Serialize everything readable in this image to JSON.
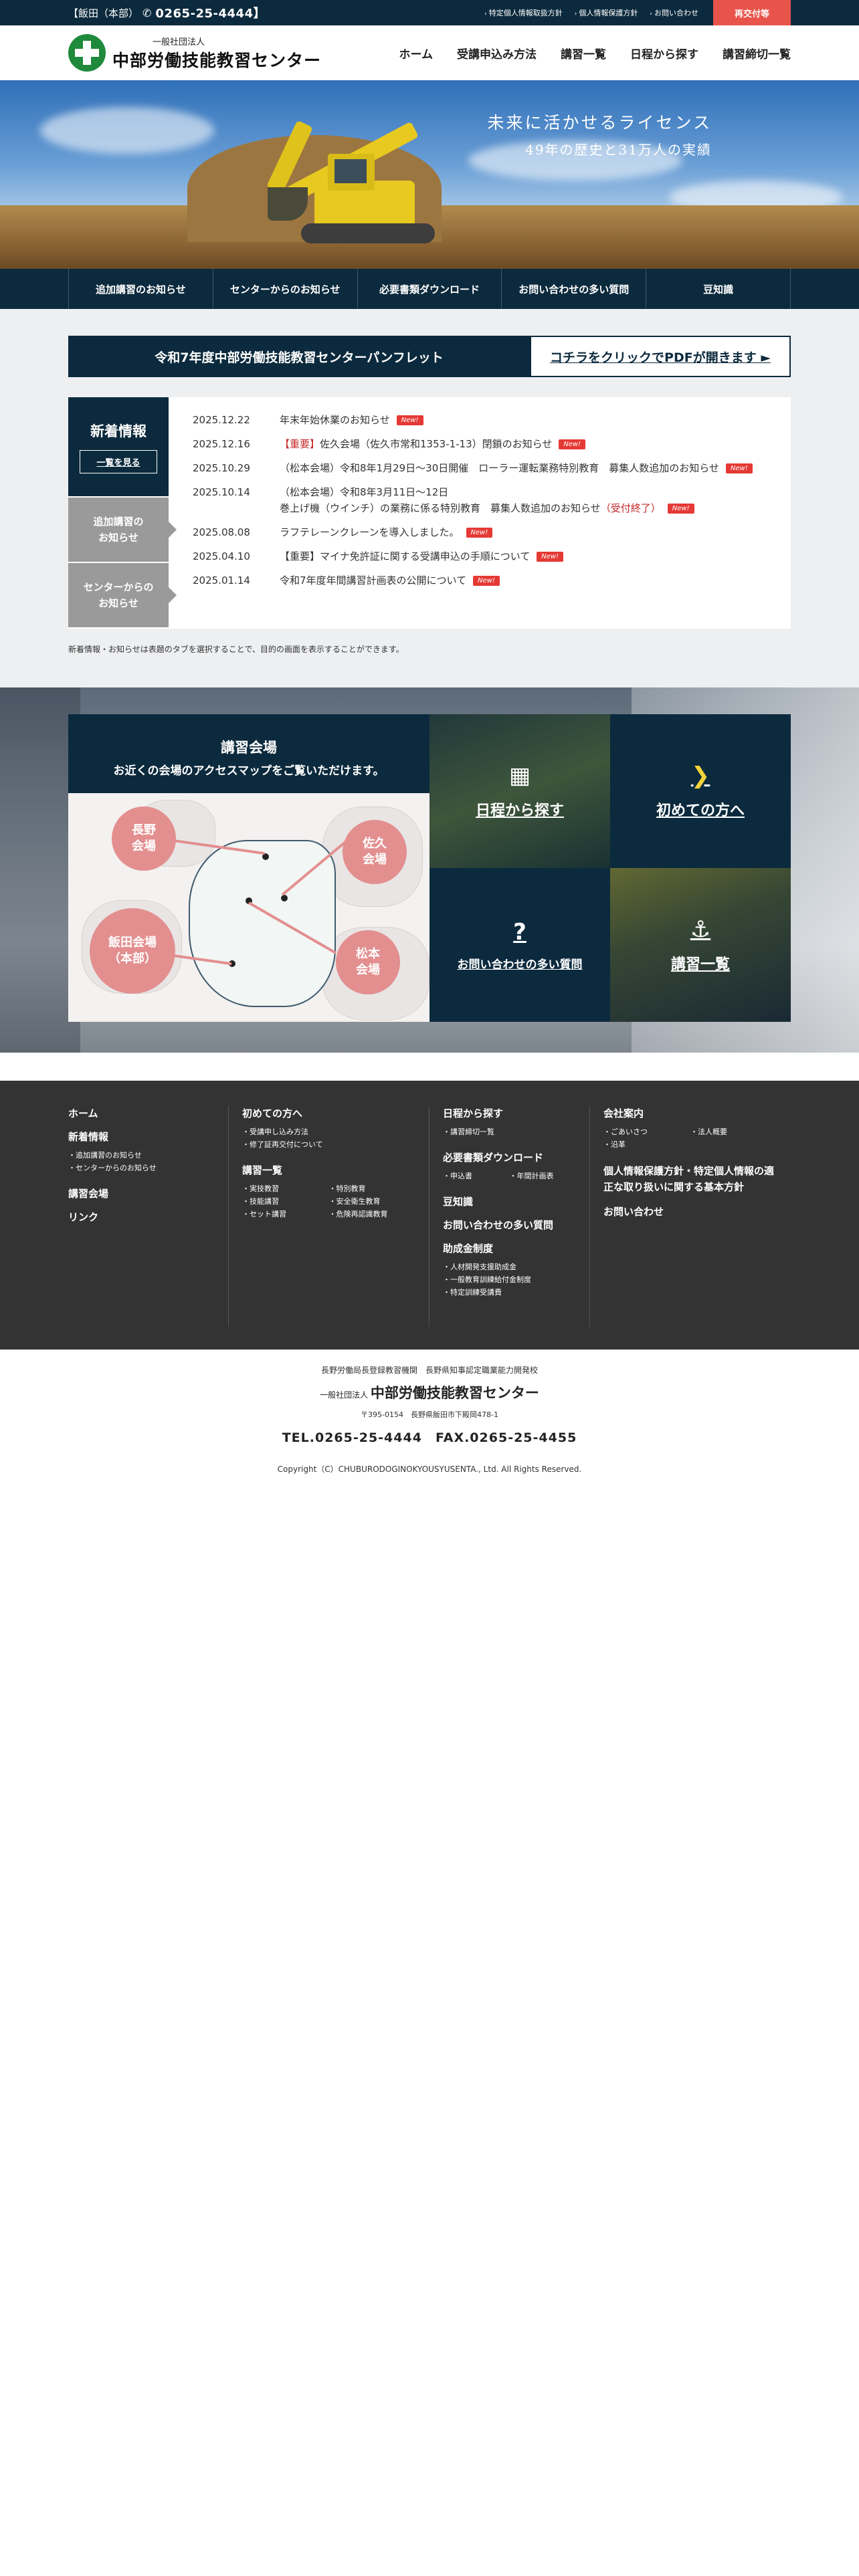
{
  "topbar": {
    "phone_label": "【飯田（本部）",
    "phone_number": "0265-25-4444】",
    "links": [
      "特定個人情報取扱方針",
      "個人情報保護方針",
      "お問い合わせ"
    ],
    "reissue": "再交付等"
  },
  "header": {
    "org_type": "一般社団法人",
    "org_name": "中部労働技能教習センター",
    "nav": [
      "ホーム",
      "受講申込み方法",
      "講習一覧",
      "日程から探す",
      "講習締切一覧"
    ]
  },
  "hero": {
    "line1": "未来に活かせるライセンス",
    "line2": "49年の歴史と31万人の実績"
  },
  "subnav": [
    "追加講習のお知らせ",
    "センターからのお知らせ",
    "必要書類ダウンロード",
    "お問い合わせの多い質問",
    "豆知識"
  ],
  "pamphlet": {
    "title": "令和7年度中部労働技能教習センターパンフレット",
    "link": "コチラをクリックでPDFが開きます ►"
  },
  "news": {
    "tab_title": "新着情報",
    "tab_more": "一覧を見る",
    "tab_additional_1": "追加講習の",
    "tab_additional_2": "お知らせ",
    "tab_center_1": "センターからの",
    "tab_center_2": "お知らせ",
    "new_label": "New!",
    "items": [
      {
        "date": "2025.12.22",
        "important": "",
        "text": "年末年始休業のお知らせ",
        "suffix": ""
      },
      {
        "date": "2025.12.16",
        "important": "【重要】",
        "text": "佐久会場（佐久市常和1353-1-13）閉鎖のお知らせ",
        "suffix": ""
      },
      {
        "date": "2025.10.29",
        "important": "",
        "text": "（松本会場）令和8年1月29日〜30日開催　ローラー運転業務特別教育　募集人数追加のお知らせ",
        "suffix": ""
      },
      {
        "date": "2025.10.14",
        "important": "",
        "text": "（松本会場）令和8年3月11日〜12日",
        "text2": "巻上げ機（ウインチ）の業務に係る特別教育　募集人数追加のお知らせ",
        "suffix": "（受付終了）"
      },
      {
        "date": "2025.08.08",
        "important": "",
        "text": "ラフテレーンクレーンを導入しました。",
        "suffix": ""
      },
      {
        "date": "2025.04.10",
        "important": "",
        "text": "【重要】マイナ免許証に関する受講申込の手順について",
        "suffix": ""
      },
      {
        "date": "2025.01.14",
        "important": "",
        "text": "令和7年度年間講習計画表の公開について",
        "suffix": ""
      }
    ],
    "note": "新着情報・お知らせは表題のタブを選択することで、目的の画面を表示することができます。"
  },
  "venue": {
    "title": "講習会場",
    "subtitle": "お近くの会場のアクセスマップをご覧いただけます。",
    "pins": {
      "nagano_1": "長野",
      "nagano_2": "会場",
      "saku_1": "佐久",
      "saku_2": "会場",
      "iida_1": "飯田会場",
      "iida_2": "（本部）",
      "matsumoto_1": "松本",
      "matsumoto_2": "会場"
    }
  },
  "tiles": {
    "schedule": "日程から探す",
    "first": "初めての方へ",
    "faq": "お問い合わせの多い質問",
    "list": "講習一覧"
  },
  "footer": {
    "col1": {
      "home": "ホーム",
      "news": "新着情報",
      "news_items": [
        "追加講習のお知らせ",
        "センターからのお知らせ"
      ],
      "venue": "講習会場",
      "link": "リンク"
    },
    "col2": {
      "first": "初めての方へ",
      "first_items": [
        "受講申し込み方法",
        "修了証再交付について"
      ],
      "list": "講習一覧",
      "list_items": [
        "実技教習",
        "特別教育",
        "技能講習",
        "安全衛生教育",
        "セット講習",
        "危険再認識教育"
      ]
    },
    "col3": {
      "schedule": "日程から探す",
      "schedule_items": [
        "講習締切一覧"
      ],
      "docs": "必要書類ダウンロード",
      "docs_items": [
        "申込書",
        "年間計画表"
      ],
      "trivia": "豆知識",
      "faq": "お問い合わせの多い質問",
      "subsidy": "助成金制度",
      "subsidy_items": [
        "人材開発支援助成金",
        "一般教育訓練給付金制度",
        "特定訓練受講費"
      ]
    },
    "col4": {
      "company": "会社案内",
      "company_items": [
        "ごあいさつ",
        "法人概要",
        "沿革"
      ],
      "privacy": "個人情報保護方針・特定個人情報の適正な取り扱いに関する基本方針",
      "contact": "お問い合わせ"
    }
  },
  "bottom": {
    "assoc": "長野労働局長登録教習機関　長野県知事認定職業能力開発校",
    "org_type": "一般社団法人",
    "org_name": "中部労働技能教習センター",
    "address": "〒395-0154　長野県飯田市下殿岡478-1",
    "tel": "TEL.0265-25-4444　FAX.0265-25-4455",
    "copyright": "Copyright（C）CHUBURODOGINOKYOUSYUSENTA., Ltd. All Rights Reserved."
  }
}
